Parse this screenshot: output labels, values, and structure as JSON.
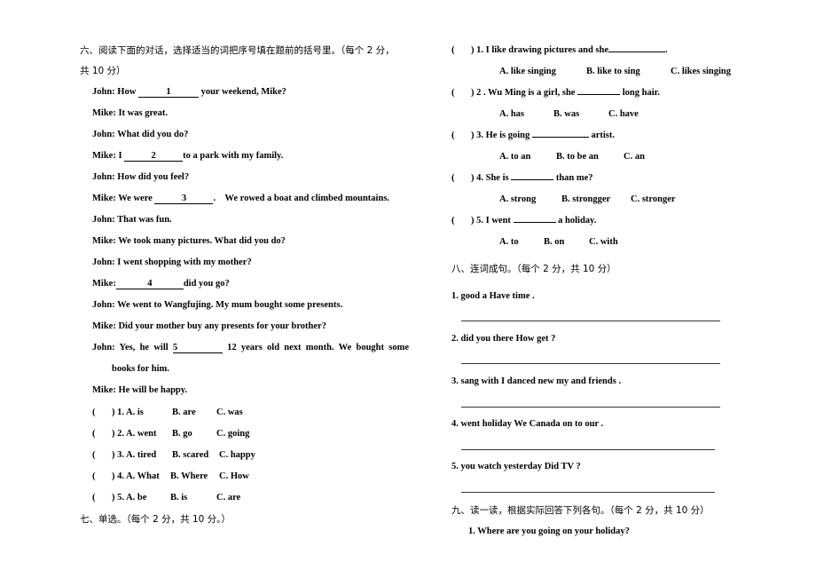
{
  "section6": {
    "heading_line1": "六、阅读下面的对话，选择适当的词把序号填在题前的括号里。（每个 2 分，",
    "heading_line2": "共 10 分）",
    "dialogue": [
      {
        "pre": "John: How ",
        "blank": "1",
        "post": " your weekend, Mike?"
      },
      {
        "text": "Mike: It was great."
      },
      {
        "text": "John: What did you do?"
      },
      {
        "pre": "Mike: I ",
        "blank": "2",
        "post": "to a park with my family."
      },
      {
        "text": "John: How did you feel?"
      },
      {
        "pre": "Mike: We were ",
        "blank": "3",
        "post": ".    We rowed a boat and climbed mountains."
      },
      {
        "text": "John: That was fun."
      },
      {
        "text": "Mike: We took many pictures. What did you do?"
      },
      {
        "text": "John: I went shopping with my mother?"
      },
      {
        "pre": "Mike:",
        "blank": "4",
        "post": "did you go?"
      },
      {
        "text": "John: We went to Wangfujing. My mum bought some presents."
      },
      {
        "text": "Mike: Did your mother buy any presents for your brother?"
      },
      {
        "pre": "John: Yes, he will ",
        "blank": "5",
        "post": " 12 years old next month. We bought some"
      },
      {
        "text": "books for him."
      },
      {
        "text": "Mike: He will be happy."
      }
    ],
    "questions": [
      {
        "num": ") 1. A. is",
        "b": "B. are",
        "c": "C. was"
      },
      {
        "num": ") 2. A. went",
        "b": "B. go",
        "c": "C. going"
      },
      {
        "num": ") 3. A. tired",
        "b": "B. scared",
        "c": "C. happy"
      },
      {
        "num": ") 4. A. What",
        "b": "B. Where",
        "c": "C. How"
      },
      {
        "num": ") 5. A. be",
        "b": "B. is",
        "c": "C. are"
      }
    ],
    "open_paren": "("
  },
  "section7": {
    "heading": "七、单选。（每个 2 分，共 10 分。）",
    "questions": [
      {
        "stem_pre": ") 1. I like drawing pictures and she",
        "stem_post": ".",
        "a": "A. like singing",
        "b": "B. like to sing",
        "c": "C. likes singing"
      },
      {
        "stem_pre": ") 2 . Wu Ming is a girl, she ",
        "stem_post": " long hair.",
        "a": "A. has",
        "b": "B. was",
        "c": "C. have"
      },
      {
        "stem_pre": ") 3. He is going ",
        "stem_post": " artist.",
        "a": "A. to an",
        "b": "B. to be an",
        "c": "C. an"
      },
      {
        "stem_pre": ") 4. She is ",
        "stem_post": " than me?",
        "a": "A. strong",
        "b": "B. strongger",
        "c": "C. stronger"
      },
      {
        "stem_pre": ") 5. I went ",
        "stem_post": " a holiday.",
        "a": "A. to",
        "b": "B. on",
        "c": "C. with"
      }
    ]
  },
  "section8": {
    "heading": "八、连词成句。（每个 2 分，共 10 分）",
    "items": [
      "1. good a Have time .",
      "2. did you there How get ?",
      "3. sang with I danced new my and friends .",
      "4. went holiday We Canada on to our .",
      "5. you watch yesterday Did TV ?"
    ]
  },
  "section9": {
    "heading": "九、读一读，根据实际回答下列各句。（每个 2 分，共 10 分）",
    "items": [
      "1. Where are you going on your holiday?"
    ]
  }
}
